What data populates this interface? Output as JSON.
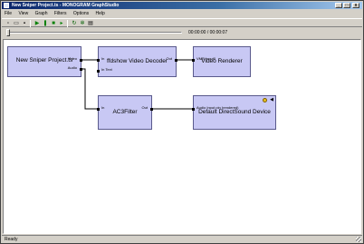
{
  "window": {
    "title": "New Sniper Project.ts - MONOGRAM GraphStudio",
    "minimize": "_",
    "maximize": "□",
    "close": "x"
  },
  "menu": [
    "File",
    "View",
    "Graph",
    "Filters",
    "Options",
    "Help"
  ],
  "toolbar": {
    "icons": [
      "new-icon",
      "open-icon",
      "save-icon",
      "play-icon",
      "pause-icon",
      "stop-icon",
      "step-icon",
      "refresh-icon",
      "settings-icon",
      "graph-icon"
    ]
  },
  "seek": {
    "time": "00:00:00 / 00:00:07",
    "position_fraction": 0.0
  },
  "filters": {
    "source": {
      "name": "New Sniper Project.ts",
      "out_video": "Video",
      "out_audio": "Audio"
    },
    "decoder": {
      "name": "ffdshow Video Decoder",
      "in": "In",
      "in_text": "In Text",
      "out": "Out"
    },
    "renderer": {
      "name": "Video Renderer",
      "in": "VMR Input0"
    },
    "ac3": {
      "name": "AC3Filter",
      "in": "In",
      "out": "Out"
    },
    "sound": {
      "name": "Default DirectSound Device",
      "in": "Audio Input pin (rendered)"
    }
  },
  "status": {
    "text": "Ready"
  },
  "colors": {
    "filter_fill": "#c8c8f4",
    "titlebar": "#0a246a"
  }
}
